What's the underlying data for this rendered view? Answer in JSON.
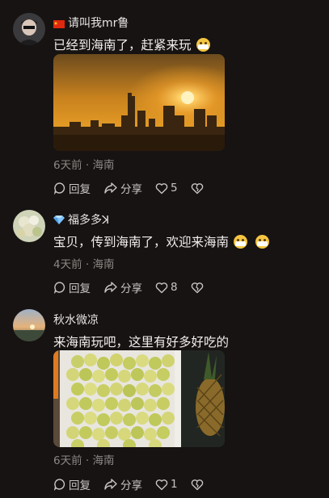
{
  "comments": [
    {
      "username": "请叫我mr鲁",
      "text": "已经到海南了，赶紧来玩",
      "meta": "6天前 · 海南",
      "reply_label": "回复",
      "share_label": "分享",
      "like_count": "5",
      "image": "sunset-city-skyline"
    },
    {
      "username": "福多多ꓘ",
      "text": "宝贝，传到海南了，欢迎来海南",
      "meta": "4天前 · 海南",
      "reply_label": "回复",
      "share_label": "分享",
      "like_count": "8"
    },
    {
      "username": "秋水微凉",
      "text": "来海南玩吧，这里有好多好吃的",
      "meta": "6天前 · 海南",
      "reply_label": "回复",
      "share_label": "分享",
      "like_count": "1",
      "image": "fruit-stall"
    }
  ],
  "colors": {
    "background": "#161312",
    "meta_text": "#8c8784"
  }
}
